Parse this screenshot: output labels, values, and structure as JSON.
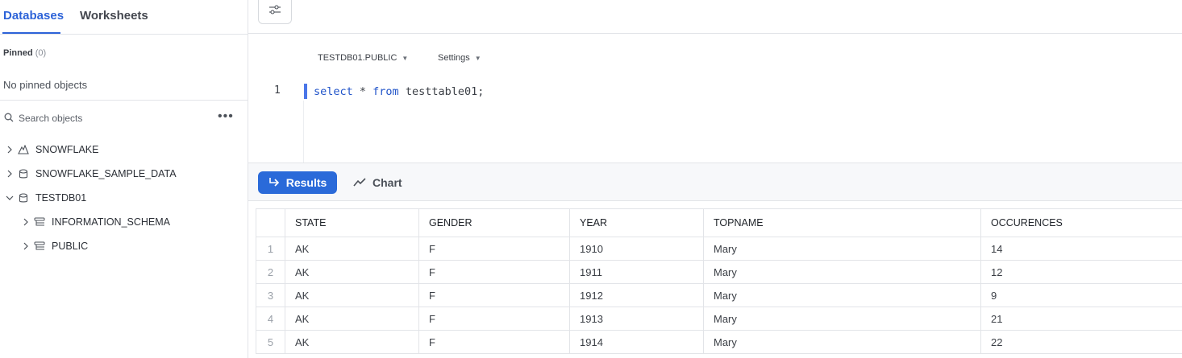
{
  "tabs": {
    "databases": "Databases",
    "worksheets": "Worksheets"
  },
  "pinned": {
    "label": "Pinned",
    "count": "(0)",
    "empty_text": "No pinned objects"
  },
  "search": {
    "placeholder": "Search objects",
    "more": "•••"
  },
  "tree": [
    {
      "label": "SNOWFLAKE",
      "icon": "snowflake-db-icon",
      "expanded": false
    },
    {
      "label": "SNOWFLAKE_SAMPLE_DATA",
      "icon": "database-icon",
      "expanded": false
    },
    {
      "label": "TESTDB01",
      "icon": "database-icon",
      "expanded": true
    },
    {
      "label": "INFORMATION_SCHEMA",
      "icon": "schema-icon",
      "expanded": false
    },
    {
      "label": "PUBLIC",
      "icon": "schema-icon",
      "expanded": false
    }
  ],
  "editor": {
    "context": "TESTDB01.PUBLIC",
    "settings": "Settings",
    "line_number": "1",
    "code": {
      "kw1": "select",
      "mid": " * ",
      "kw2": "from",
      "rest": " testtable01;"
    }
  },
  "results": {
    "results_label": "Results",
    "chart_label": "Chart"
  },
  "table": {
    "columns": [
      "STATE",
      "GENDER",
      "YEAR",
      "TOPNAME",
      "OCCURENCES"
    ],
    "rows": [
      [
        "1",
        "AK",
        "F",
        "1910",
        "Mary",
        "14"
      ],
      [
        "2",
        "AK",
        "F",
        "1911",
        "Mary",
        "12"
      ],
      [
        "3",
        "AK",
        "F",
        "1912",
        "Mary",
        "9"
      ],
      [
        "4",
        "AK",
        "F",
        "1913",
        "Mary",
        "21"
      ],
      [
        "5",
        "AK",
        "F",
        "1914",
        "Mary",
        "22"
      ]
    ]
  },
  "colors": {
    "accent": "#2a6ad9",
    "tab_active": "#2d63d8",
    "keyword": "#2154c9"
  }
}
